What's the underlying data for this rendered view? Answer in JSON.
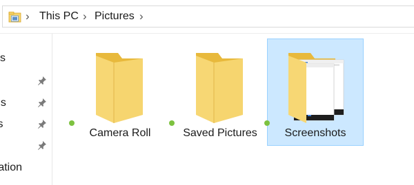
{
  "address": {
    "crumbs": [
      "This PC",
      "Pictures"
    ]
  },
  "nav": {
    "items": [
      {
        "text": "ss"
      },
      {
        "text": "ds"
      },
      {
        "text": "ts"
      },
      {
        "text": "ration"
      }
    ]
  },
  "items": [
    {
      "label": "Camera Roll",
      "selected": false
    },
    {
      "label": "Saved Pictures",
      "selected": false
    },
    {
      "label": "Screenshots",
      "selected": true
    }
  ],
  "colors": {
    "folder": "#f6d56f",
    "folder_dark": "#e8b93c",
    "selection_bg": "#cce8ff",
    "selection_border": "#99d1ff",
    "sync_status": "#7dc240"
  },
  "icons": {
    "address": "pictures-folder-icon",
    "separator": "chevron-right-icon",
    "pin": "pin-icon",
    "folder": "folder-icon",
    "status": "sync-status-icon"
  }
}
